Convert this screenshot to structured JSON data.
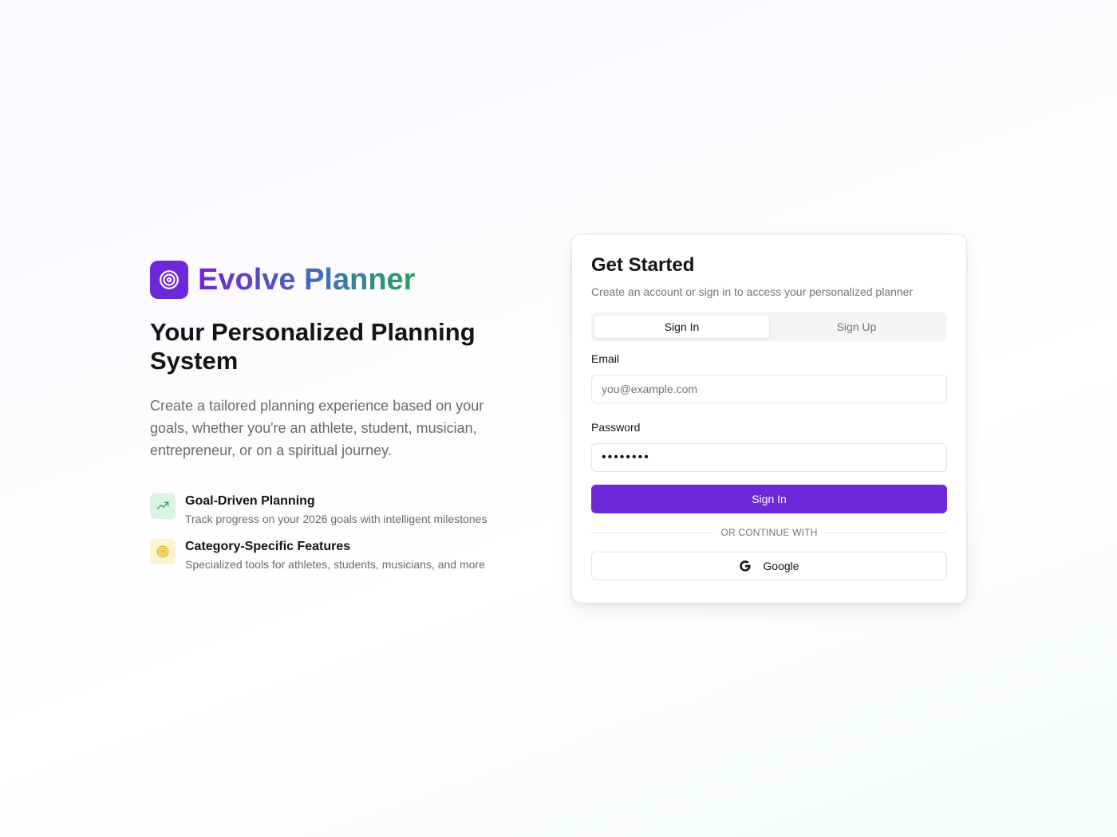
{
  "brand": {
    "name": "Evolve Planner",
    "logo_icon": "target-icon",
    "logo_color": "#6d28d9"
  },
  "hero": {
    "headline": "Your Personalized Planning System",
    "subtext": "Create a tailored planning experience based on your goals, whether you're an athlete, student, musician, entrepreneur, or on a spiritual journey.",
    "features": [
      {
        "icon": "trending-up-icon",
        "title": "Goal-Driven Planning",
        "description": "Track progress on your 2026 goals with intelligent milestones"
      },
      {
        "icon": "target-icon",
        "title": "Category-Specific Features",
        "description": "Specialized tools for athletes, students, musicians, and more"
      }
    ]
  },
  "auth": {
    "title": "Get Started",
    "description": "Create an account or sign in to access your personalized planner",
    "tabs": [
      {
        "label": "Sign In",
        "active": true
      },
      {
        "label": "Sign Up",
        "active": false
      }
    ],
    "email_label": "Email",
    "email_placeholder": "you@example.com",
    "password_label": "Password",
    "password_value": "••••••••",
    "submit_label": "Sign In",
    "divider_text": "OR CONTINUE WITH",
    "google_label": "Google"
  },
  "colors": {
    "primary": "#6d28d9",
    "feature_green_bg": "#dcf3e4",
    "feature_yellow_bg": "#fdf3cc"
  }
}
